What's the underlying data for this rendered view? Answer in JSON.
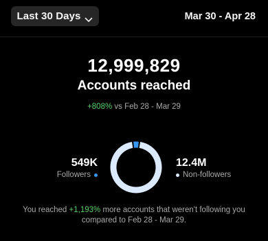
{
  "filter": {
    "range_label": "Last 30 Days",
    "chevron_icon": "chevron-down-icon"
  },
  "header": {
    "date_range": "Mar 30 - Apr 28"
  },
  "summary": {
    "accounts_reached_value": "12,999,829",
    "accounts_reached_label": "Accounts reached",
    "change_percent": "+808%",
    "change_comparison": " vs Feb 28 - Mar 29"
  },
  "audience": {
    "followers": {
      "value": "549K",
      "label": "Followers",
      "color": "#3797f0"
    },
    "non_followers": {
      "value": "12.4M",
      "label": "Non-followers",
      "color": "#dbeafe"
    },
    "chart_data": {
      "type": "pie",
      "categories": [
        "Followers",
        "Non-followers"
      ],
      "values": [
        549000,
        12400000
      ]
    }
  },
  "footer": {
    "prefix": "You reached ",
    "highlight": "+1,193%",
    "suffix": " more accounts that weren't following you compared to Feb 28 - Mar 29."
  },
  "colors": {
    "background": "#000000",
    "accent_green": "#5bd06a",
    "muted_text": "#a8a8a8",
    "button_bg": "#262626"
  }
}
